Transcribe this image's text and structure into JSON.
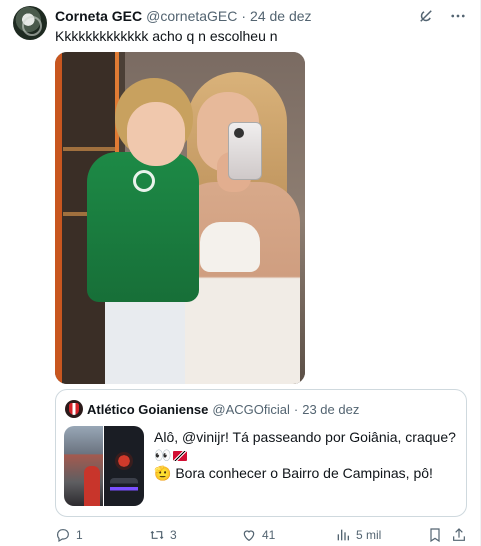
{
  "author": {
    "name": "Corneta GEC",
    "handle": "@cornetaGEC",
    "separator": "·",
    "date": "24 de dez"
  },
  "tweet_text": "Kkkkkkkkkkkkk acho q n escolheu n",
  "top_icons": [
    "grok-icon",
    "more-icon"
  ],
  "quoted": {
    "name": "Atlético Goianiense",
    "handle": "@ACGOficial",
    "separator": "·",
    "date": "23 de dez",
    "line1": "Alô, @vinijr! Tá passeando por Goiânia, craque? 👀",
    "line2": "🫡 Bora conhecer o Bairro de Campinas, pô!"
  },
  "actions": {
    "replies": "1",
    "reposts": "3",
    "likes": "41",
    "views": "5 mil"
  },
  "colors": {
    "text": "#0f1419",
    "muted": "#536471",
    "border": "#cfd9de"
  }
}
